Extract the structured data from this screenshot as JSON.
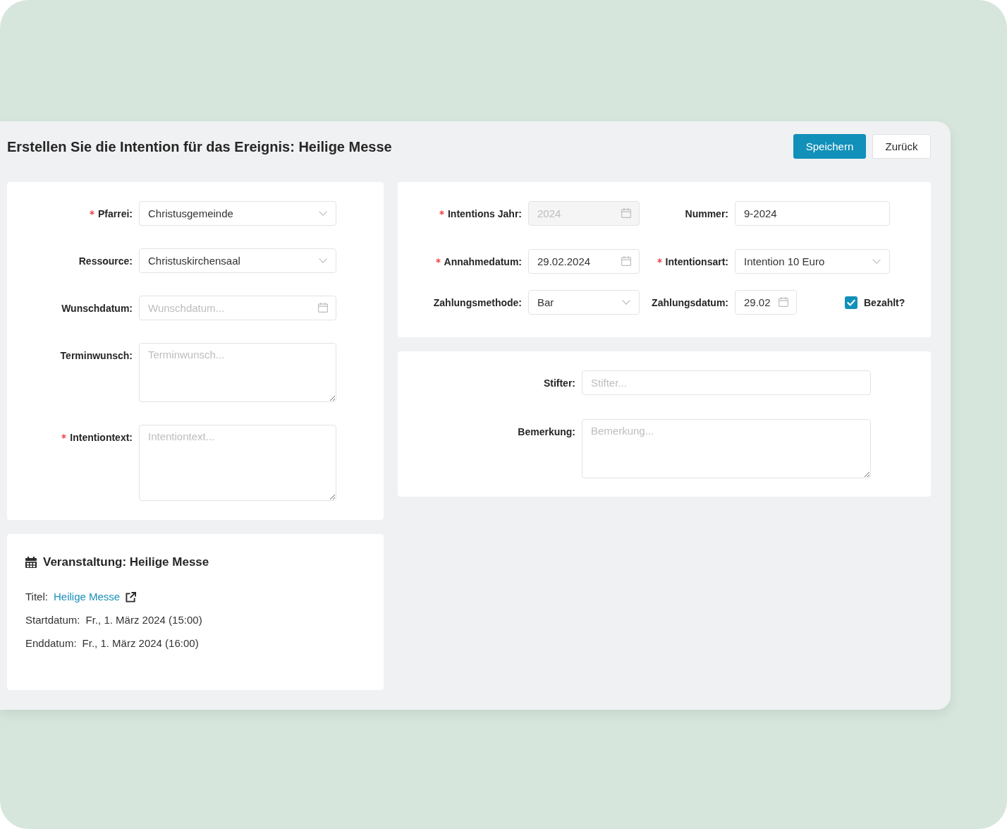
{
  "page": {
    "title": "Erstellen Sie die Intention für das Ereignis: Heilige Messe"
  },
  "actions": [
    {
      "label": "Speichern",
      "kind": "primary"
    },
    {
      "label": "Zurück",
      "kind": "default"
    }
  ],
  "general_form": {
    "fields": [
      {
        "label": "Pfarrei:",
        "required": true,
        "kind": "select",
        "value": "Christusgemeinde"
      },
      {
        "label": "Ressource:",
        "required": false,
        "kind": "select",
        "value": "Christuskirchensaal"
      },
      {
        "label": "Wunschdatum:",
        "required": false,
        "kind": "date",
        "placeholder": "Wunschdatum..."
      },
      {
        "label": "Terminwunsch:",
        "required": false,
        "kind": "textarea",
        "placeholder": "Terminwunsch..."
      },
      {
        "label": "Intentiontext:",
        "required": true,
        "kind": "textarea",
        "placeholder": "Intentiontext..."
      }
    ]
  },
  "intention_form": {
    "fields": [
      {
        "label": "Intentions Jahr:",
        "required": true,
        "kind": "date",
        "value": "2024",
        "disabled": true
      },
      {
        "label": "Nummer:",
        "required": false,
        "kind": "text",
        "value": "9-2024",
        "disabled": false
      },
      {
        "label": "Annahmedatum:",
        "required": true,
        "kind": "date",
        "value": "29.02.2024",
        "disabled": false
      },
      {
        "label": "Intentionsart:",
        "required": true,
        "kind": "select",
        "value": "Intention 10 Euro",
        "disabled": false
      },
      {
        "label": "Zahlungsmethode:",
        "required": false,
        "kind": "select",
        "value": "Bar",
        "disabled": false
      },
      {
        "label": "Zahlungsdatum:",
        "required": false,
        "kind": "date",
        "value": "29.02",
        "disabled": false
      }
    ],
    "paid": {
      "label": "Bezahlt?",
      "checked": true
    }
  },
  "donor_form": {
    "fields": [
      {
        "label": "Stifter:",
        "required": false,
        "kind": "text",
        "placeholder": "Stifter..."
      },
      {
        "label": "Bemerkung:",
        "required": false,
        "kind": "textarea",
        "placeholder": "Bemerkung..."
      }
    ]
  },
  "event": {
    "title": "Veranstaltung: Heilige Messe",
    "details": [
      {
        "label": "Titel:",
        "value": "Heilige Messe",
        "kind": "link"
      },
      {
        "label": "Startdatum:",
        "value": "Fr., 1. März 2024 (15:00)",
        "kind": "text"
      },
      {
        "label": "Enddatum:",
        "value": "Fr., 1. März 2024 (16:00)",
        "kind": "text"
      }
    ]
  }
}
